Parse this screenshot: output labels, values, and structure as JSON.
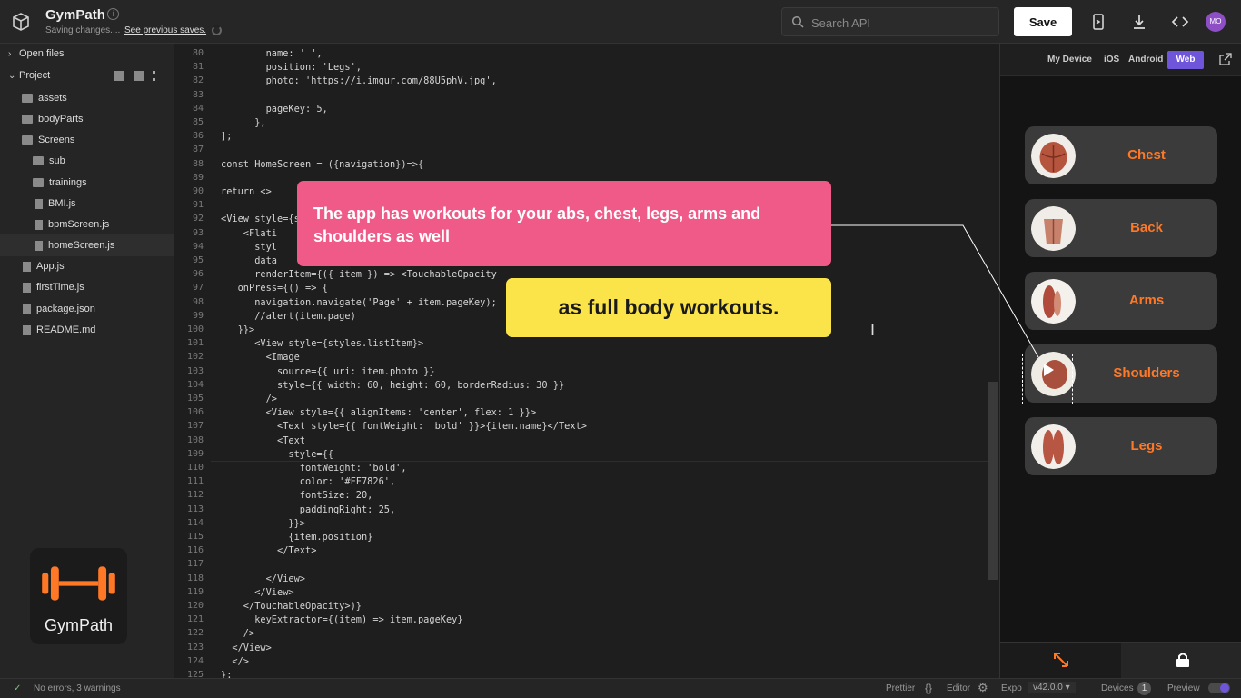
{
  "header": {
    "app_title": "GymPath",
    "saving_status": "Saving changes....",
    "saving_link": "See previous saves.",
    "search_placeholder": "Search API",
    "save_label": "Save",
    "avatar_initials": "MO"
  },
  "sidebar": {
    "open_files_label": "Open files",
    "project_label": "Project",
    "tree": [
      {
        "label": "assets",
        "type": "folder"
      },
      {
        "label": "bodyParts",
        "type": "folder"
      },
      {
        "label": "Screens",
        "type": "folder-open"
      },
      {
        "label": "sub",
        "type": "folder"
      },
      {
        "label": "trainings",
        "type": "folder"
      },
      {
        "label": "BMI.js",
        "type": "file"
      },
      {
        "label": "bpmScreen.js",
        "type": "file"
      },
      {
        "label": "homeScreen.js",
        "type": "file",
        "selected": true
      },
      {
        "label": "App.js",
        "type": "file"
      },
      {
        "label": "firstTime.js",
        "type": "file"
      },
      {
        "label": "package.json",
        "type": "file"
      },
      {
        "label": "README.md",
        "type": "file"
      }
    ],
    "brand_name": "GymPath"
  },
  "editor": {
    "line_numbers": [
      "80",
      "81",
      "82",
      "83",
      "84",
      "85",
      "86",
      "87",
      "88",
      "89",
      "90",
      "91",
      "92",
      "93",
      "94",
      "95",
      "96",
      "97",
      "98",
      "99",
      "100",
      "101",
      "102",
      "103",
      "104",
      "105",
      "106",
      "107",
      "108",
      "109",
      "110",
      "111",
      "112",
      "113",
      "114",
      "115",
      "116",
      "117",
      "118",
      "119",
      "120",
      "121",
      "122",
      "123",
      "124",
      "125"
    ],
    "lines": [
      "        name: ' ',",
      "        position: 'Legs',",
      "        photo: 'https://i.imgur.com/88U5phV.jpg',",
      "",
      "        pageKey: 5,",
      "      },",
      "];",
      "",
      "const HomeScreen = ({navigation})=>{",
      "",
      "return <>",
      "",
      "<View style={s",
      "    <Flati",
      "      styl",
      "      data",
      "      renderItem={({ item }) => <TouchableOpacity",
      "   onPress={() => {",
      "      navigation.navigate('Page' + item.pageKey);",
      "      //alert(item.page)",
      "   }}>",
      "      <View style={styles.listItem}>",
      "        <Image",
      "          source={{ uri: item.photo }}",
      "          style={{ width: 60, height: 60, borderRadius: 30 }}",
      "        />",
      "        <View style={{ alignItems: 'center', flex: 1 }}>",
      "          <Text style={{ fontWeight: 'bold' }}>{item.name}</Text>",
      "          <Text",
      "            style={{",
      "              fontWeight: 'bold',",
      "              color: '#FF7826',",
      "              fontSize: 20,",
      "              paddingRight: 25,",
      "            }}>",
      "            {item.position}",
      "          </Text>",
      "",
      "        </View>",
      "      </View>",
      "    </TouchableOpacity>)}",
      "      keyExtractor={(item) => item.pageKey}",
      "    />",
      "  </View>",
      "  </>",
      "};"
    ]
  },
  "device": {
    "tabs": [
      "My Device",
      "iOS",
      "Android",
      "Web"
    ],
    "active_tab": "Web",
    "cards": [
      {
        "label": "Chest"
      },
      {
        "label": "Back"
      },
      {
        "label": "Arms"
      },
      {
        "label": "Shoulders"
      },
      {
        "label": "Legs"
      }
    ]
  },
  "status_bar": {
    "errors": "No errors, 3 warnings",
    "prettier": "Prettier",
    "editor": "Editor",
    "expo": "Expo",
    "expo_version": "v42.0.0",
    "devices": "Devices",
    "devices_count": "1",
    "preview": "Preview"
  },
  "captions": {
    "top": "The app has workouts for your abs, chest, legs, arms and shoulders as well",
    "bottom": "as full body workouts."
  },
  "colors": {
    "accent_orange": "#ff7826",
    "caption_pink": "#ef5a88",
    "caption_yellow": "#fbe44a",
    "web_tab": "#6e55d9"
  }
}
